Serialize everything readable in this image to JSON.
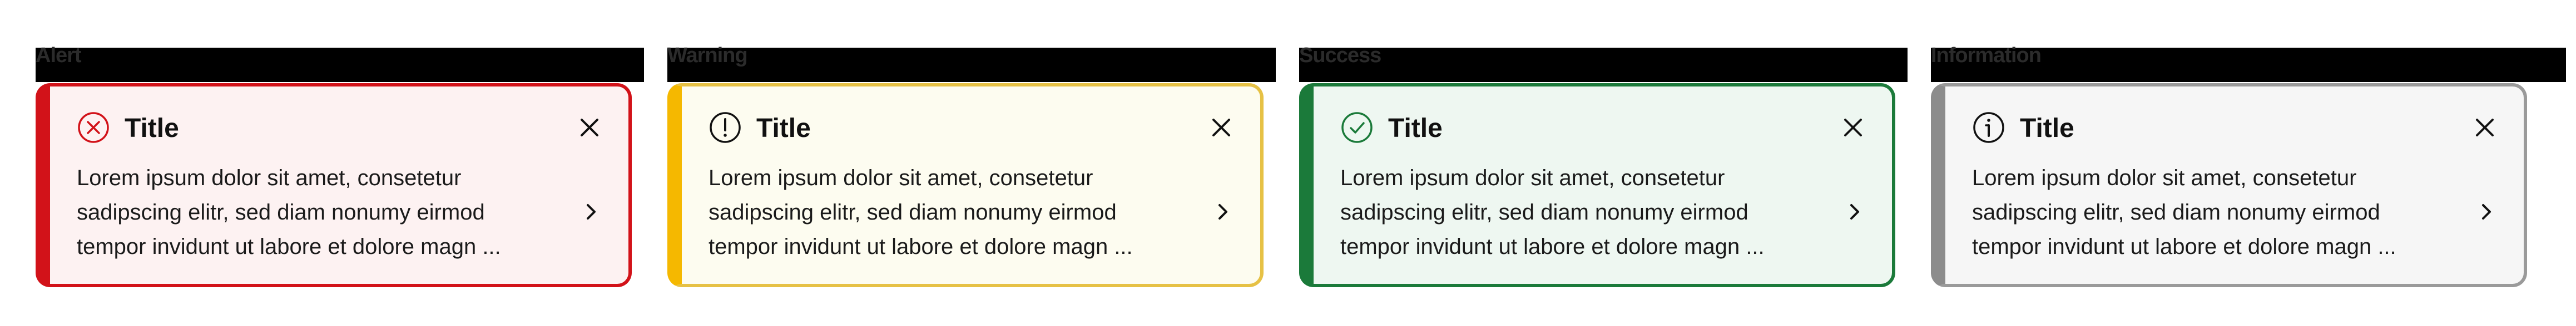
{
  "notifications": [
    {
      "variant": "alert",
      "group_label": "Alert",
      "icon": "x-circle-icon",
      "accent": "#d21219",
      "title": "Title",
      "body": "Lorem ipsum dolor sit amet, consetetur\nsadipscing elitr, sed diam nonumy eirmod\ntempor invidunt ut labore et dolore magn ..."
    },
    {
      "variant": "warning",
      "group_label": "Warning",
      "icon": "exclamation-circle-icon",
      "accent": "#f5b800",
      "title": "Title",
      "body": "Lorem ipsum dolor sit amet, consetetur\nsadipscing elitr, sed diam nonumy eirmod\ntempor invidunt ut labore et dolore magn ..."
    },
    {
      "variant": "success",
      "group_label": "Success",
      "icon": "check-circle-icon",
      "accent": "#1b7a3a",
      "title": "Title",
      "body": "Lorem ipsum dolor sit amet, consetetur\nsadipscing elitr, sed diam nonumy eirmod\ntempor invidunt ut labore et dolore magn ..."
    },
    {
      "variant": "info",
      "group_label": "Information",
      "icon": "info-circle-icon",
      "accent": "#8c8c8c",
      "title": "Title",
      "body": "Lorem ipsum dolor sit amet, consetetur\nsadipscing elitr, sed diam nonumy eirmod\ntempor invidunt ut labore et dolore magn ..."
    }
  ]
}
